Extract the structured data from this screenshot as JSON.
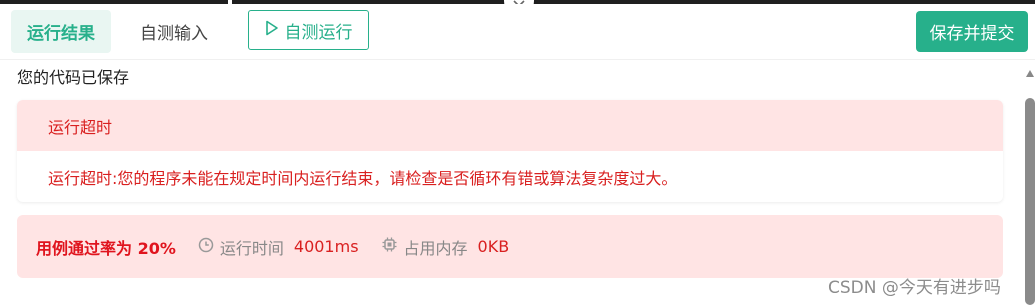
{
  "toolbar": {
    "tabs": [
      {
        "label": "运行结果",
        "active": true
      },
      {
        "label": "自测输入",
        "active": false
      }
    ],
    "run_label": "自测运行",
    "save_label": "保存并提交"
  },
  "status": {
    "saved_message": "您的代码已保存"
  },
  "result": {
    "title": "运行超时",
    "detail": "运行超时:您的程序未能在规定时间内运行结束，请检查是否循环有错或算法复杂度过大。"
  },
  "summary": {
    "pass_rate": "用例通过率为 20%",
    "time_label": "运行时间",
    "time_value": "4001ms",
    "memory_label": "占用内存",
    "memory_value": "0KB"
  },
  "watermark": "CSDN @今天有进步吗",
  "colors": {
    "accent": "#27b08b",
    "error": "#d92020",
    "error_bg": "#ffe4e4"
  },
  "icons": {
    "run": "play-icon",
    "time": "clock-icon",
    "memory": "chip-icon",
    "collapse": "chevron-down-icon"
  }
}
